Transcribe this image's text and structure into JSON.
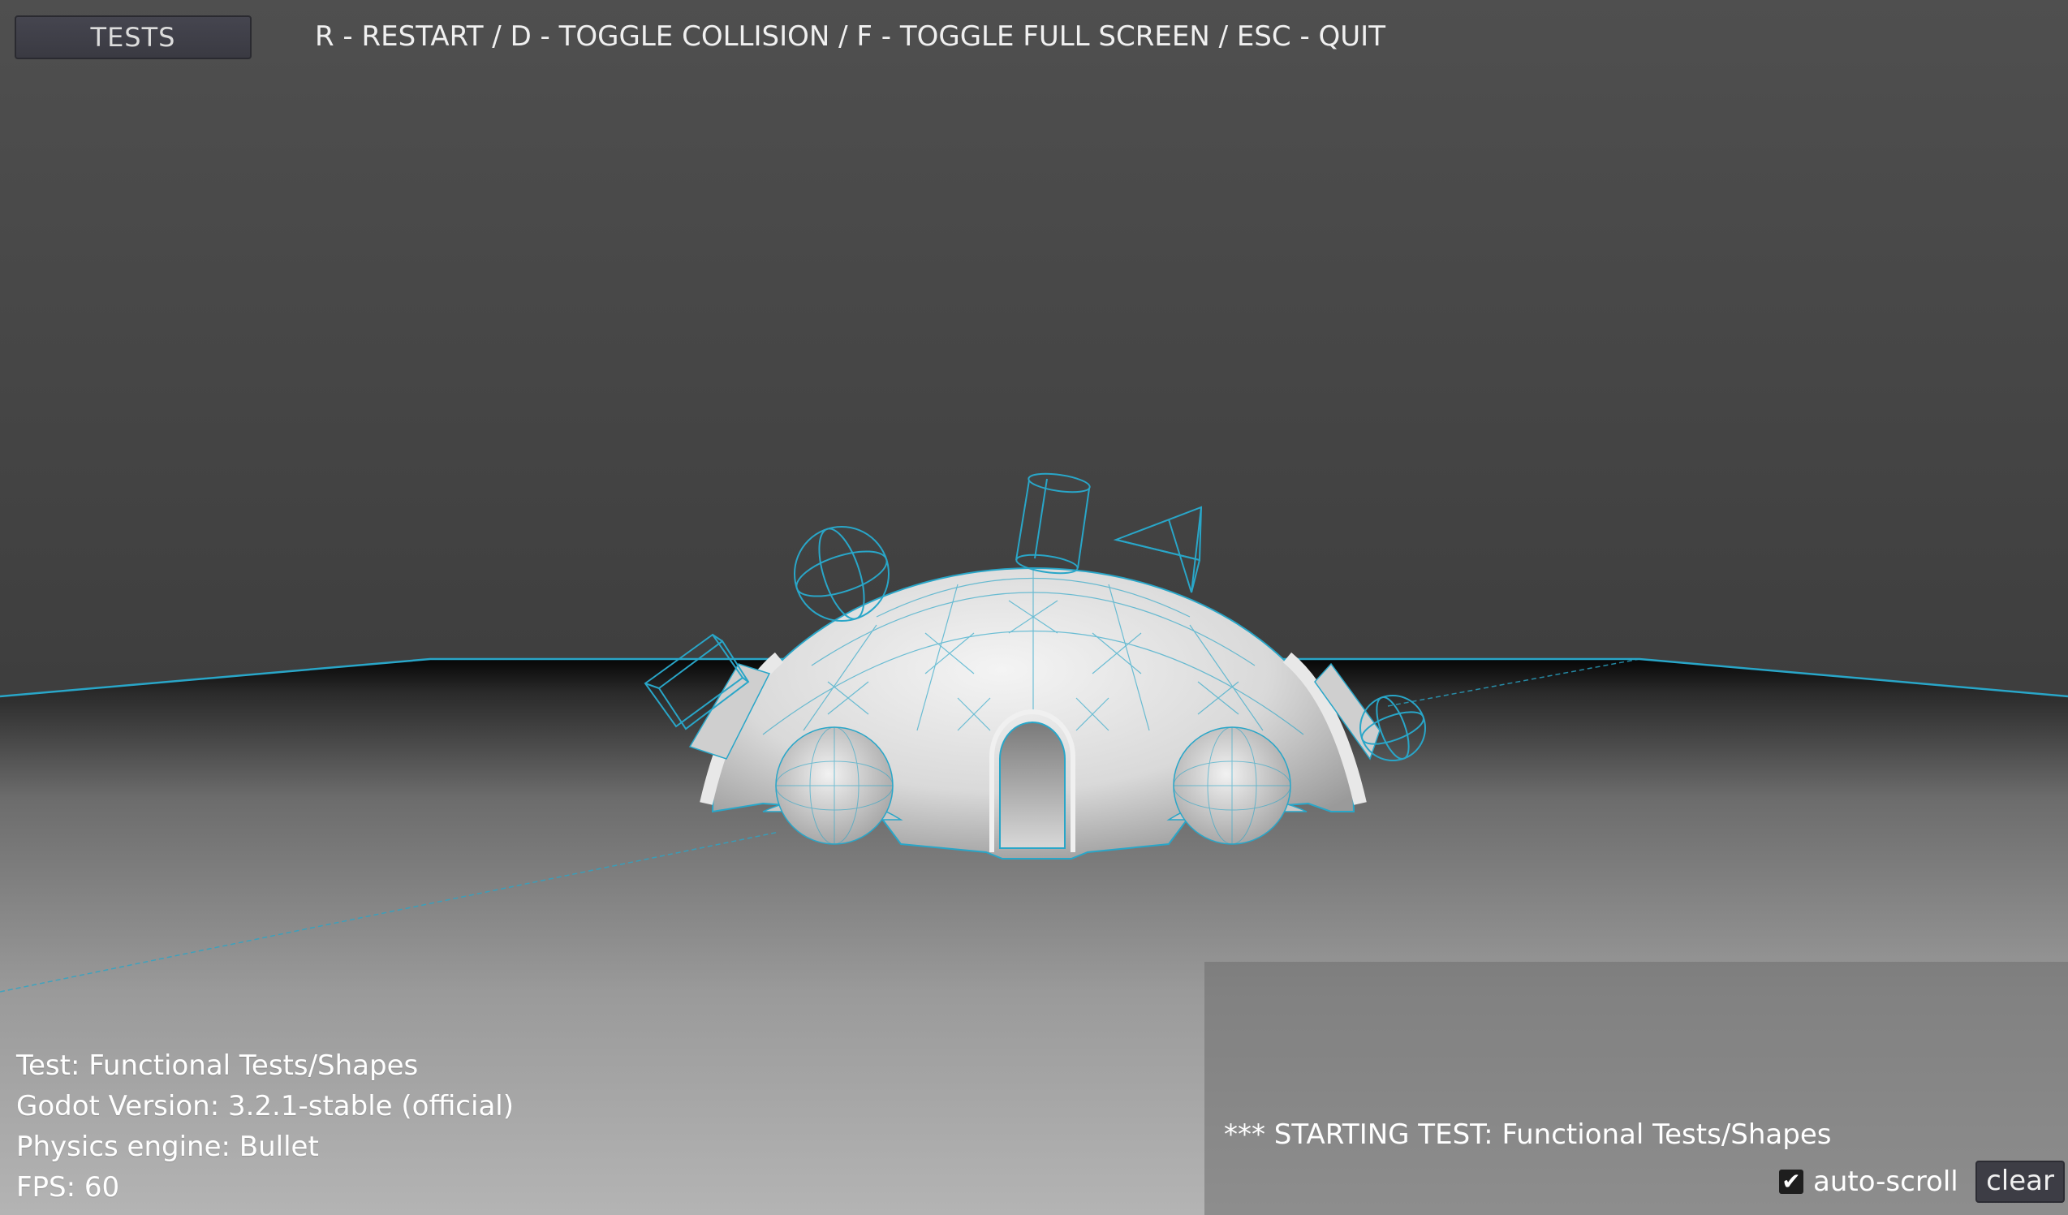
{
  "toolbar": {
    "tests_label": "TESTS",
    "hotkeys": "R - RESTART / D - TOGGLE COLLISION / F - TOGGLE FULL SCREEN / ESC - QUIT"
  },
  "info": {
    "test": "Test: Functional Tests/Shapes",
    "godot_version": "Godot Version: 3.2.1-stable (official)",
    "physics_engine": "Physics engine: Bullet",
    "fps": "FPS: 60"
  },
  "log": {
    "line": "*** STARTING TEST: Functional Tests/Shapes",
    "autoscroll_label": "auto-scroll",
    "autoscroll_checked": true,
    "clear_label": "clear"
  },
  "colors": {
    "sky": "#4d4d4d",
    "collision_debug": "#29a6c8",
    "horizon": "#050505",
    "ground_light": "#b0b0b0"
  }
}
